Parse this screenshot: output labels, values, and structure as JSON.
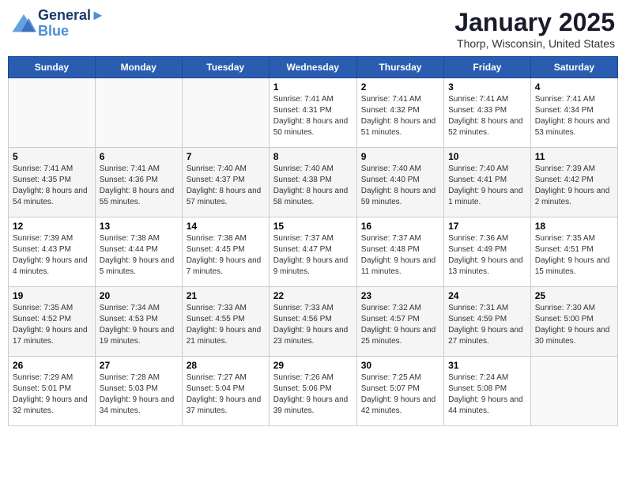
{
  "header": {
    "logo_line1": "General",
    "logo_line2": "Blue",
    "month": "January 2025",
    "location": "Thorp, Wisconsin, United States"
  },
  "days_of_week": [
    "Sunday",
    "Monday",
    "Tuesday",
    "Wednesday",
    "Thursday",
    "Friday",
    "Saturday"
  ],
  "weeks": [
    [
      {
        "num": "",
        "sunrise": "",
        "sunset": "",
        "daylight": ""
      },
      {
        "num": "",
        "sunrise": "",
        "sunset": "",
        "daylight": ""
      },
      {
        "num": "",
        "sunrise": "",
        "sunset": "",
        "daylight": ""
      },
      {
        "num": "1",
        "sunrise": "Sunrise: 7:41 AM",
        "sunset": "Sunset: 4:31 PM",
        "daylight": "Daylight: 8 hours and 50 minutes."
      },
      {
        "num": "2",
        "sunrise": "Sunrise: 7:41 AM",
        "sunset": "Sunset: 4:32 PM",
        "daylight": "Daylight: 8 hours and 51 minutes."
      },
      {
        "num": "3",
        "sunrise": "Sunrise: 7:41 AM",
        "sunset": "Sunset: 4:33 PM",
        "daylight": "Daylight: 8 hours and 52 minutes."
      },
      {
        "num": "4",
        "sunrise": "Sunrise: 7:41 AM",
        "sunset": "Sunset: 4:34 PM",
        "daylight": "Daylight: 8 hours and 53 minutes."
      }
    ],
    [
      {
        "num": "5",
        "sunrise": "Sunrise: 7:41 AM",
        "sunset": "Sunset: 4:35 PM",
        "daylight": "Daylight: 8 hours and 54 minutes."
      },
      {
        "num": "6",
        "sunrise": "Sunrise: 7:41 AM",
        "sunset": "Sunset: 4:36 PM",
        "daylight": "Daylight: 8 hours and 55 minutes."
      },
      {
        "num": "7",
        "sunrise": "Sunrise: 7:40 AM",
        "sunset": "Sunset: 4:37 PM",
        "daylight": "Daylight: 8 hours and 57 minutes."
      },
      {
        "num": "8",
        "sunrise": "Sunrise: 7:40 AM",
        "sunset": "Sunset: 4:38 PM",
        "daylight": "Daylight: 8 hours and 58 minutes."
      },
      {
        "num": "9",
        "sunrise": "Sunrise: 7:40 AM",
        "sunset": "Sunset: 4:40 PM",
        "daylight": "Daylight: 8 hours and 59 minutes."
      },
      {
        "num": "10",
        "sunrise": "Sunrise: 7:40 AM",
        "sunset": "Sunset: 4:41 PM",
        "daylight": "Daylight: 9 hours and 1 minute."
      },
      {
        "num": "11",
        "sunrise": "Sunrise: 7:39 AM",
        "sunset": "Sunset: 4:42 PM",
        "daylight": "Daylight: 9 hours and 2 minutes."
      }
    ],
    [
      {
        "num": "12",
        "sunrise": "Sunrise: 7:39 AM",
        "sunset": "Sunset: 4:43 PM",
        "daylight": "Daylight: 9 hours and 4 minutes."
      },
      {
        "num": "13",
        "sunrise": "Sunrise: 7:38 AM",
        "sunset": "Sunset: 4:44 PM",
        "daylight": "Daylight: 9 hours and 5 minutes."
      },
      {
        "num": "14",
        "sunrise": "Sunrise: 7:38 AM",
        "sunset": "Sunset: 4:45 PM",
        "daylight": "Daylight: 9 hours and 7 minutes."
      },
      {
        "num": "15",
        "sunrise": "Sunrise: 7:37 AM",
        "sunset": "Sunset: 4:47 PM",
        "daylight": "Daylight: 9 hours and 9 minutes."
      },
      {
        "num": "16",
        "sunrise": "Sunrise: 7:37 AM",
        "sunset": "Sunset: 4:48 PM",
        "daylight": "Daylight: 9 hours and 11 minutes."
      },
      {
        "num": "17",
        "sunrise": "Sunrise: 7:36 AM",
        "sunset": "Sunset: 4:49 PM",
        "daylight": "Daylight: 9 hours and 13 minutes."
      },
      {
        "num": "18",
        "sunrise": "Sunrise: 7:35 AM",
        "sunset": "Sunset: 4:51 PM",
        "daylight": "Daylight: 9 hours and 15 minutes."
      }
    ],
    [
      {
        "num": "19",
        "sunrise": "Sunrise: 7:35 AM",
        "sunset": "Sunset: 4:52 PM",
        "daylight": "Daylight: 9 hours and 17 minutes."
      },
      {
        "num": "20",
        "sunrise": "Sunrise: 7:34 AM",
        "sunset": "Sunset: 4:53 PM",
        "daylight": "Daylight: 9 hours and 19 minutes."
      },
      {
        "num": "21",
        "sunrise": "Sunrise: 7:33 AM",
        "sunset": "Sunset: 4:55 PM",
        "daylight": "Daylight: 9 hours and 21 minutes."
      },
      {
        "num": "22",
        "sunrise": "Sunrise: 7:33 AM",
        "sunset": "Sunset: 4:56 PM",
        "daylight": "Daylight: 9 hours and 23 minutes."
      },
      {
        "num": "23",
        "sunrise": "Sunrise: 7:32 AM",
        "sunset": "Sunset: 4:57 PM",
        "daylight": "Daylight: 9 hours and 25 minutes."
      },
      {
        "num": "24",
        "sunrise": "Sunrise: 7:31 AM",
        "sunset": "Sunset: 4:59 PM",
        "daylight": "Daylight: 9 hours and 27 minutes."
      },
      {
        "num": "25",
        "sunrise": "Sunrise: 7:30 AM",
        "sunset": "Sunset: 5:00 PM",
        "daylight": "Daylight: 9 hours and 30 minutes."
      }
    ],
    [
      {
        "num": "26",
        "sunrise": "Sunrise: 7:29 AM",
        "sunset": "Sunset: 5:01 PM",
        "daylight": "Daylight: 9 hours and 32 minutes."
      },
      {
        "num": "27",
        "sunrise": "Sunrise: 7:28 AM",
        "sunset": "Sunset: 5:03 PM",
        "daylight": "Daylight: 9 hours and 34 minutes."
      },
      {
        "num": "28",
        "sunrise": "Sunrise: 7:27 AM",
        "sunset": "Sunset: 5:04 PM",
        "daylight": "Daylight: 9 hours and 37 minutes."
      },
      {
        "num": "29",
        "sunrise": "Sunrise: 7:26 AM",
        "sunset": "Sunset: 5:06 PM",
        "daylight": "Daylight: 9 hours and 39 minutes."
      },
      {
        "num": "30",
        "sunrise": "Sunrise: 7:25 AM",
        "sunset": "Sunset: 5:07 PM",
        "daylight": "Daylight: 9 hours and 42 minutes."
      },
      {
        "num": "31",
        "sunrise": "Sunrise: 7:24 AM",
        "sunset": "Sunset: 5:08 PM",
        "daylight": "Daylight: 9 hours and 44 minutes."
      },
      {
        "num": "",
        "sunrise": "",
        "sunset": "",
        "daylight": ""
      }
    ]
  ]
}
